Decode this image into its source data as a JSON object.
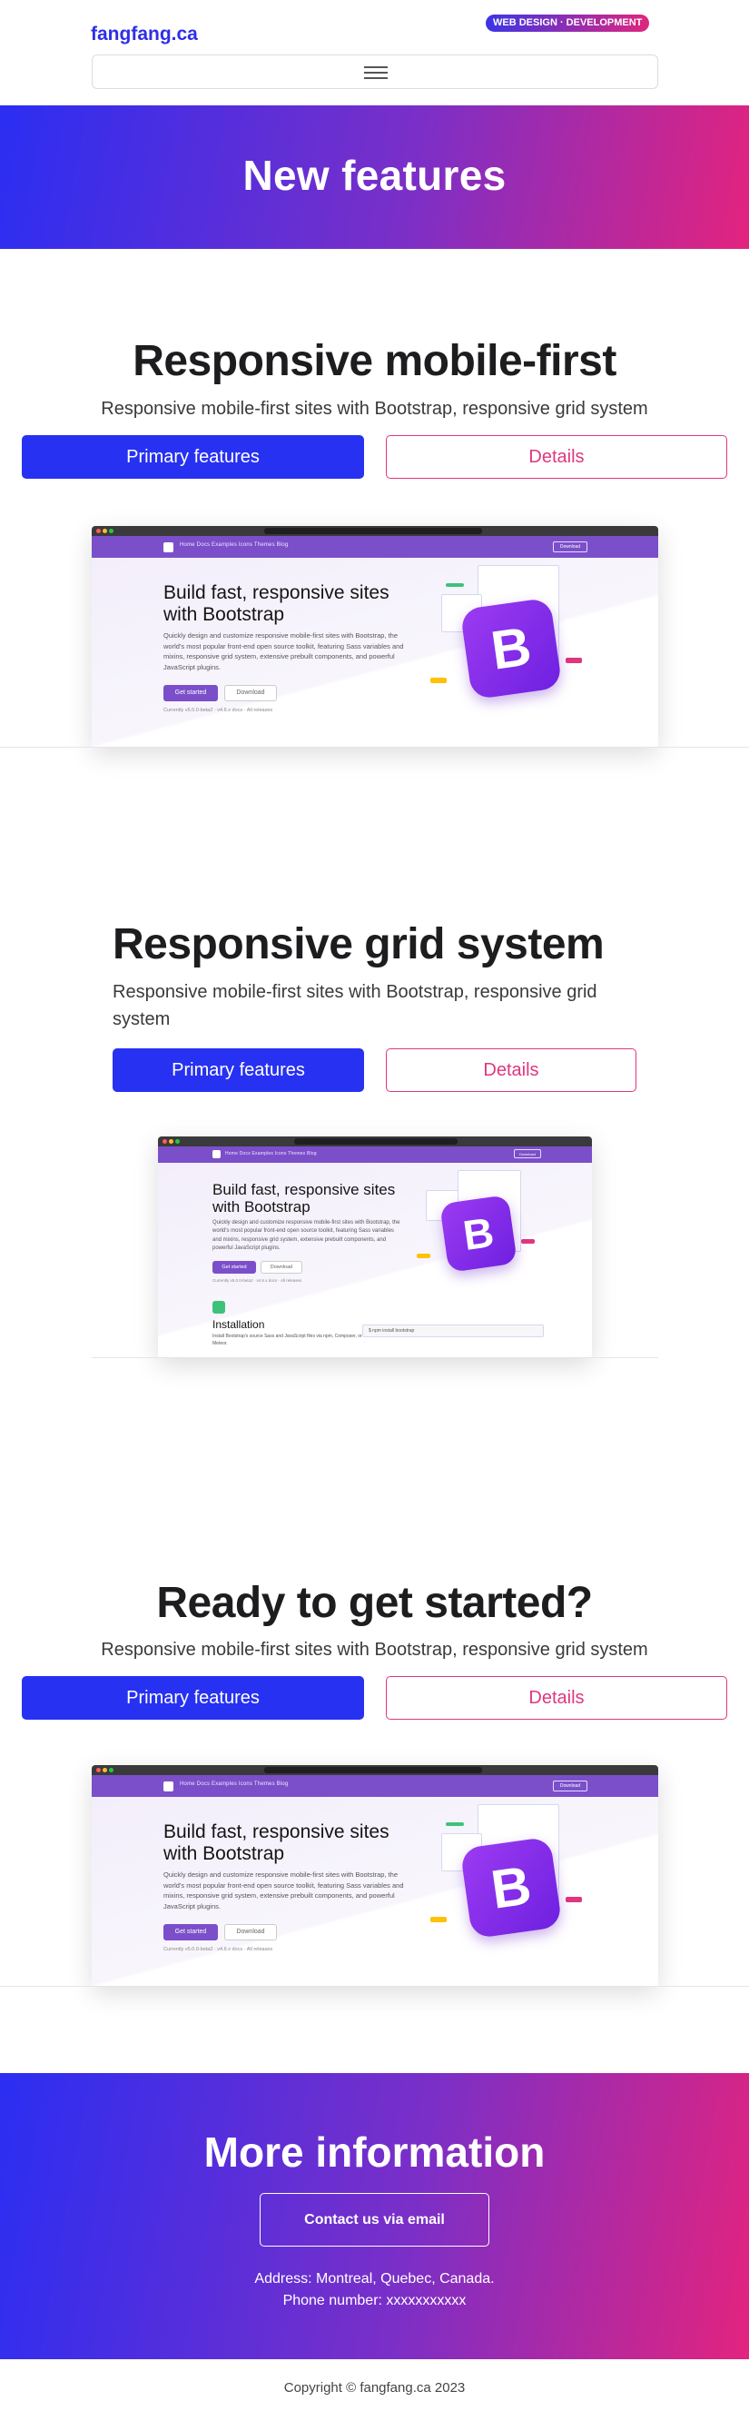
{
  "header": {
    "brand": "fangfang.ca",
    "badge": "WEB DESIGN · DEVELOPMENT"
  },
  "hero": {
    "title": "New features"
  },
  "sections": [
    {
      "title": "Responsive mobile-first",
      "subtitle": "Responsive mobile-first sites with Bootstrap, responsive grid system",
      "primary_label": "Primary features",
      "secondary_label": "Details"
    },
    {
      "title": "Responsive grid system",
      "subtitle": "Responsive mobile-first sites with Bootstrap, responsive grid system",
      "primary_label": "Primary features",
      "secondary_label": "Details"
    },
    {
      "title": "Ready to get started?",
      "subtitle": "Responsive mobile-first sites with Bootstrap, responsive grid system",
      "primary_label": "Primary features",
      "secondary_label": "Details"
    }
  ],
  "mockup": {
    "nav_links": "Home   Docs   Examples   Icons   Themes   Blog",
    "download": "Download",
    "title": "Build fast, responsive sites with Bootstrap",
    "paragraph": "Quickly design and customize responsive mobile-first sites with Bootstrap, the world's most popular front-end open source toolkit, featuring Sass variables and mixins, responsive grid system, extensive prebuilt components, and powerful JavaScript plugins.",
    "btn_primary": "Get started",
    "btn_secondary": "Download",
    "version": "Currently v5.0.0-beta2 · v4.6.x docs · All releases",
    "logo_letter": "B",
    "install_title": "Installation",
    "install_text": "Install Bootstrap's source Sass and JavaScript files via npm, Composer, or Meteor.",
    "install_cmd": "$ npm install bootstrap"
  },
  "more_info": {
    "title": "More information",
    "contact_label": "Contact us via email",
    "address": "Address: Montreal, Quebec, Canada.",
    "phone": "Phone number: xxxxxxxxxxx"
  },
  "footer": {
    "copyright": "Copyright © fangfang.ca 2023"
  },
  "colors": {
    "primary": "#2731f2",
    "accent": "#e0367f",
    "gradient_start": "#2b2ef2",
    "gradient_end": "#e3237e",
    "bootstrap_purple": "#7b4fc9"
  },
  "icons": [
    "hamburger-menu-icon",
    "bootstrap-logo-icon"
  ]
}
